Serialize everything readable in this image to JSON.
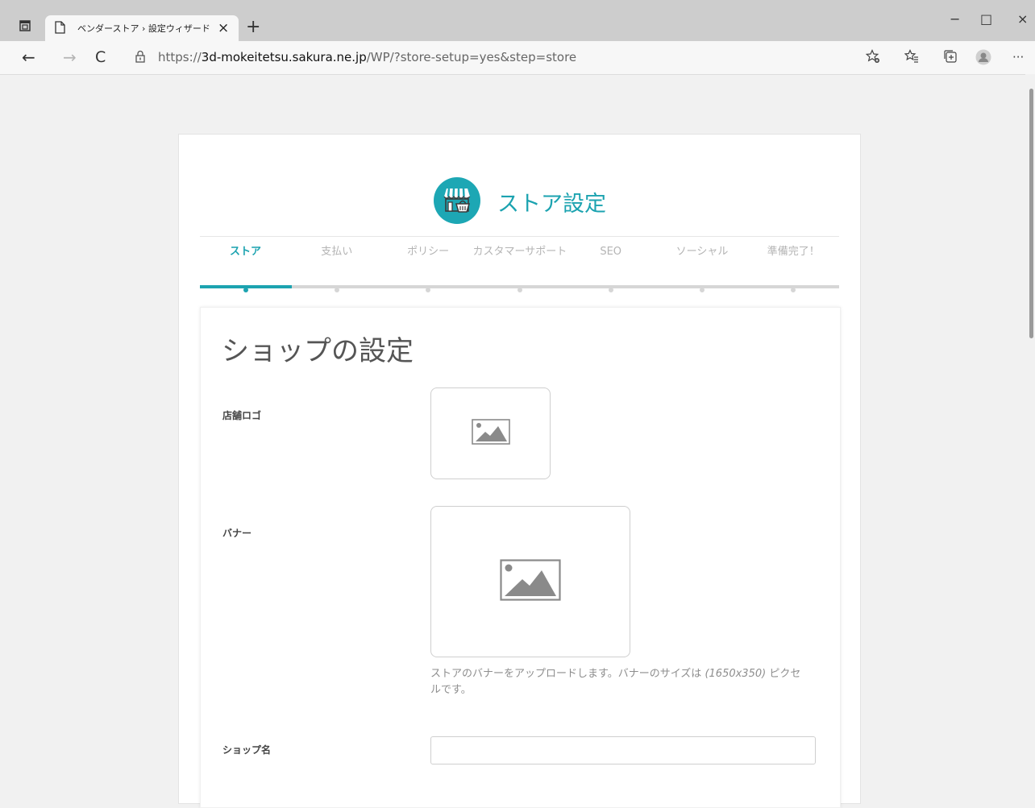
{
  "browser": {
    "tab_title": "ベンダーストア › 設定ウィザード",
    "url_scheme": "https://",
    "url_host": "3d-mokeitetsu.sakura.ne.jp",
    "url_path": "/WP/?store-setup=yes&step=store",
    "newtab_glyph": "+",
    "tab_close_glyph": "×",
    "back_glyph": "←",
    "forward_glyph": "→",
    "refresh_glyph": "C",
    "minimize_glyph": "−",
    "maximize_glyph": "□",
    "close_glyph": "×",
    "more_glyph": "···"
  },
  "wizard": {
    "title": "ストア設定",
    "accent_color": "#1ca3b0",
    "steps": [
      {
        "label": "ストア",
        "active": true
      },
      {
        "label": "支払い",
        "active": false
      },
      {
        "label": "ポリシー",
        "active": false
      },
      {
        "label": "カスタマーサポート",
        "active": false
      },
      {
        "label": "SEO",
        "active": false
      },
      {
        "label": "ソーシャル",
        "active": false
      },
      {
        "label": "準備完了！",
        "active": false
      }
    ]
  },
  "form": {
    "section_title": "ショップの設定",
    "logo_label": "店舗ロゴ",
    "banner_label": "バナー",
    "banner_help_prefix": "ストアのバナーをアップロードします。バナーのサイズは ",
    "banner_help_dims": "(1650x350)",
    "banner_help_suffix": " ピクセルです。",
    "shop_name_label": "ショップ名",
    "shop_name_value": ""
  },
  "icons": {
    "logo_placeholder": "image-placeholder-icon",
    "banner_placeholder": "image-placeholder-icon",
    "wizard_logo": "store-icon"
  }
}
